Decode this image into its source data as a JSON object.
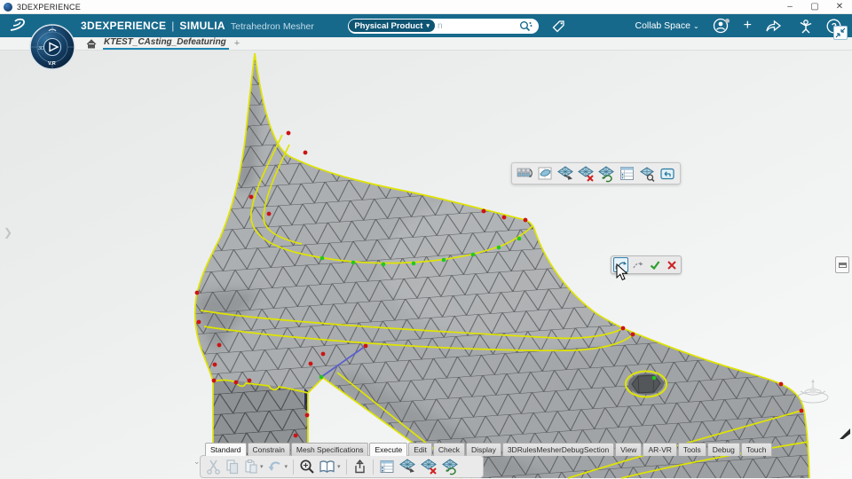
{
  "window": {
    "title": "3DEXPERIENCE",
    "minimize": "–",
    "maximize": "▢",
    "close": "✕"
  },
  "app_bar": {
    "brand_bold": "3DEXPERIENCE",
    "separator": "|",
    "app_name": "SIMULIA",
    "app_module": "Tetrahedron Mesher",
    "compass": {
      "west_label": "3D",
      "south_label": "V.R"
    },
    "search": {
      "scope_chip": "Physical Product",
      "scope_caret": "▾",
      "typed_text": "n"
    },
    "collab_space_label": "Collab Space",
    "collab_caret": "⌄",
    "add_button": "+",
    "help_label": "?",
    "right_icons": [
      "user-avatar",
      "add",
      "share",
      "people",
      "help"
    ]
  },
  "tab_bar": {
    "active_tab": "KTEST_CAsting_Defeaturing",
    "new_tab_button": "+"
  },
  "viewport": {
    "colors": {
      "mesh_fill": "#a9acae",
      "mesh_edge": "#46494d",
      "feature_edge": "#dfe400",
      "free_node_green": "#21c81f",
      "constrained_node_red": "#cc1414",
      "selected_edge_blue": "#5a5fd0",
      "background_top": "#e6e8e8",
      "background_bottom": "#f8f9f9"
    },
    "context_toolbar_icons": [
      "import-mesh",
      "surface-mesh",
      "update-mesh",
      "delete-mesh",
      "regenerate-mesh",
      "mesh-specifications",
      "inspect-mesh",
      "exit-capability"
    ],
    "edit_toolbar_icons": [
      "insert-edge",
      "swap-edge",
      "ok",
      "cancel"
    ],
    "edit_toolbar_colors": {
      "ok": "#2ea02e",
      "cancel": "#cc2222"
    },
    "side_controls": [
      "expand-left-panel",
      "collapse-viewport",
      "panel-handle"
    ]
  },
  "action_bar": {
    "tabs": [
      {
        "label": "Standard",
        "active": true
      },
      {
        "label": "Constrain",
        "active": false
      },
      {
        "label": "Mesh Specifications",
        "active": false
      },
      {
        "label": "Execute",
        "active": true
      },
      {
        "label": "Edit",
        "active": false
      },
      {
        "label": "Check",
        "active": false
      },
      {
        "label": "Display",
        "active": false
      },
      {
        "label": "3DRulesMesherDebugSection",
        "active": false
      },
      {
        "label": "View",
        "active": false
      },
      {
        "label": "AR-VR",
        "active": false
      },
      {
        "label": "Tools",
        "active": false
      },
      {
        "label": "Debug",
        "active": false
      },
      {
        "label": "Touch",
        "active": false
      }
    ],
    "tools": [
      "cut",
      "copy",
      "paste",
      "undo",
      "zoom",
      "catalog-browser",
      "share-export",
      "mesh-specs-table",
      "update-mesh",
      "delete-mesh",
      "regenerate-mesh"
    ]
  }
}
